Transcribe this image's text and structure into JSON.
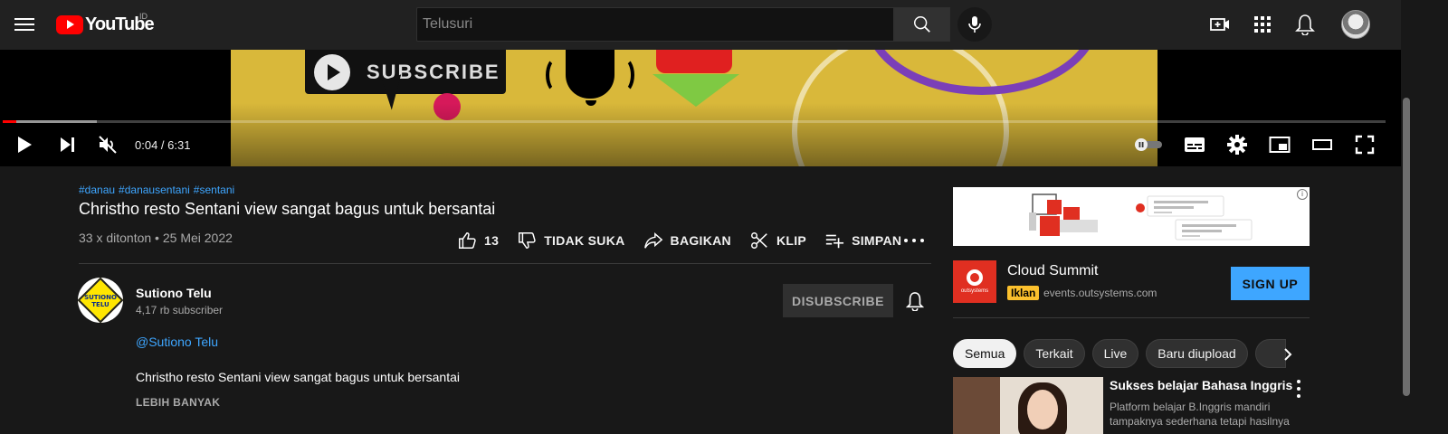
{
  "header": {
    "logo_text": "YouTube",
    "country_code": "ID",
    "search_placeholder": "Telusuri"
  },
  "player": {
    "video_text": "SUBSCRIBE",
    "current_time": "0:04",
    "duration": "6:31",
    "time_display": "0:04 / 6:31",
    "progress_fraction": 0.01,
    "buffered_fraction": 0.068,
    "muted": true
  },
  "video": {
    "hashtags": [
      "#danau",
      "#danausentani",
      "#sentani"
    ],
    "title": "Christho resto Sentani view sangat bagus untuk bersantai",
    "meta": "33 x ditonton • 25 Mei 2022",
    "like_count": "13",
    "dislike_label": "TIDAK SUKA",
    "share_label": "BAGIKAN",
    "clip_label": "KLIP",
    "save_label": "SIMPAN"
  },
  "channel": {
    "avatar_text": "SUTIONO TELU",
    "name": "Sutiono Telu",
    "subscribers": "4,17 rb subscriber",
    "unsubscribe_label": "DISUBSCRIBE",
    "handle": "@Sutiono Telu",
    "description": "Christho resto Sentani view sangat bagus untuk bersantai",
    "show_more_label": "LEBIH BANYAK"
  },
  "ad": {
    "title": "Cloud Summit",
    "badge": "Iklan",
    "domain": "events.outsystems.com",
    "logo_label": "outsystems",
    "cta_label": "SIGN UP"
  },
  "chips": [
    "Semua",
    "Terkait",
    "Live",
    "Baru diupload"
  ],
  "recommendation": {
    "title": "Sukses belajar Bahasa Inggris",
    "description_lines": [
      "Platform belajar B.Inggris mandiri",
      "tampaknya sederhana tetapi hasilnya"
    ]
  },
  "colors": {
    "accent_red": "#ff0000",
    "link_blue": "#3ea6ff",
    "ad_badge": "#fbc02d",
    "background": "#181818"
  }
}
